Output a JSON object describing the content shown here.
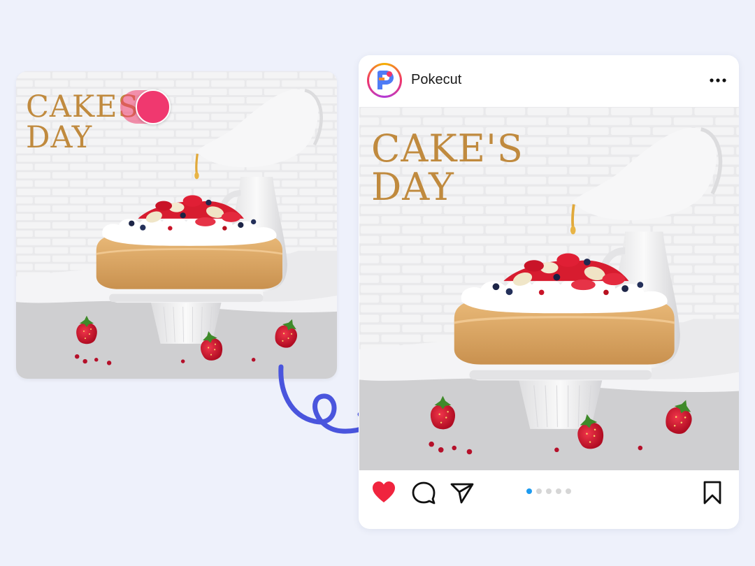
{
  "source_image": {
    "title_lines": [
      "CAKES",
      "DAY"
    ],
    "eraser_color": "#f0386f"
  },
  "post": {
    "username": "Pokecut",
    "more_icon": "more-horizontal-icon",
    "image_title_lines": [
      "CAKE'S",
      "DAY"
    ],
    "actions": {
      "like": "heart-icon",
      "comment": "comment-icon",
      "share": "send-icon",
      "save": "bookmark-icon"
    },
    "carousel": {
      "count": 5,
      "active_index": 0
    }
  },
  "arrow": {
    "icon": "curly-arrow-icon",
    "color": "#4a55dd"
  },
  "colors": {
    "background": "#eef1fb",
    "title_gold": "#c08a3e",
    "like_red": "#f0243e",
    "active_dot": "#1d9bf0"
  }
}
